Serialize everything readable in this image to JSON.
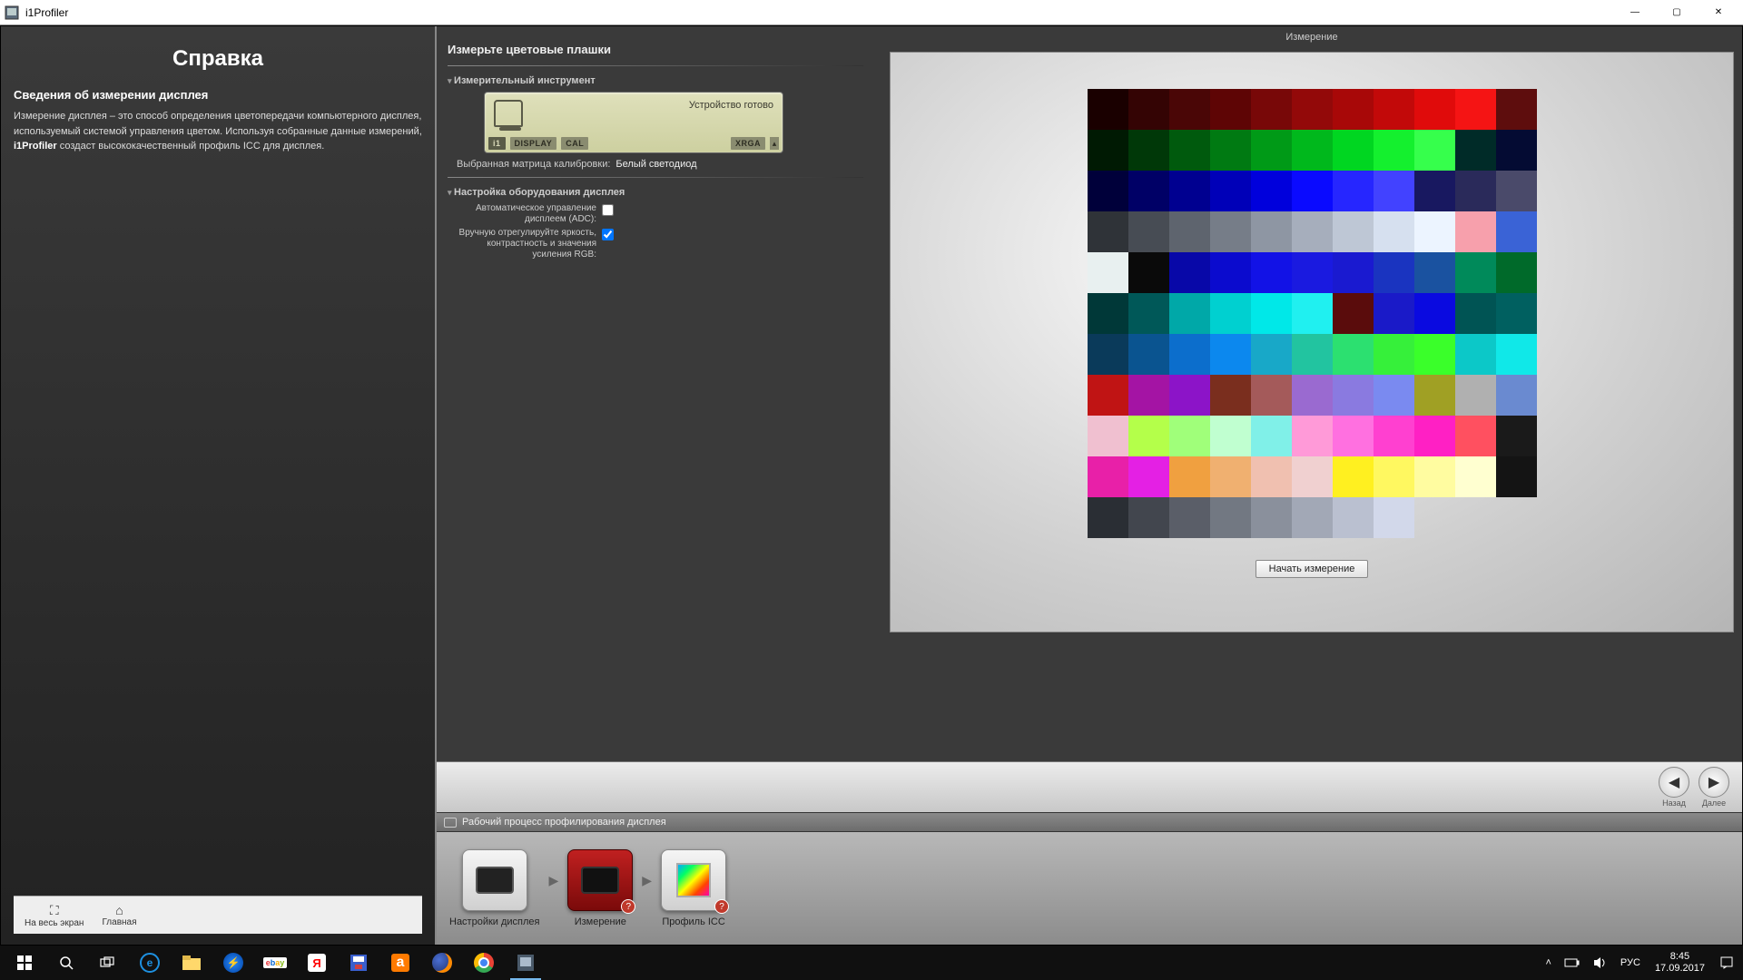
{
  "window": {
    "title": "i1Profiler",
    "minimize": "—",
    "maximize": "▢",
    "close": "✕"
  },
  "help": {
    "title": "Справка",
    "subtitle": "Сведения об измерении дисплея",
    "body_pre": "Измерение дисплея – это способ определения цветопередачи компьютерного дисплея, используемый системой управления цветом. Используя собранные данные измерений, ",
    "body_bold": "i1Profiler",
    "body_post": " создаст высококачественный профиль ICC для дисплея.",
    "footer_fullscreen": "На весь экран",
    "footer_home": "Главная"
  },
  "page": {
    "heading": "Измерьте цветовые плашки"
  },
  "instrument": {
    "section": "Измерительный инструмент",
    "status": "Устройство готово",
    "badge_i1": "i1",
    "badge_display": "DISPLAY",
    "badge_cal": "CAL",
    "badge_xrga": "XRGA",
    "matrix_label": "Выбранная матрица калибровки:",
    "matrix_value": "Белый светодиод"
  },
  "hardware": {
    "section": "Настройка оборудования дисплея",
    "adc_label": "Автоматическое управление дисплеем (ADC):",
    "manual_label": "Вручную отрегулируйте яркость, контрастность и значения усиления RGB:"
  },
  "preview": {
    "title": "Измерение",
    "start": "Начать измерение",
    "patches": [
      [
        "#1a0000",
        "#340404",
        "#4a0606",
        "#5e0505",
        "#780808",
        "#930909",
        "#a80808",
        "#c20909",
        "#e00b0b",
        "#f51414",
        "#5e0d0d"
      ],
      [
        "#001a03",
        "#003808",
        "#005a0d",
        "#007a12",
        "#009a17",
        "#00b81c",
        "#00d621",
        "#14f02e",
        "#36ff4c",
        "#002b28",
        "#040b33"
      ],
      [
        "#00003a",
        "#000066",
        "#000090",
        "#0000b8",
        "#0000dc",
        "#0a0aff",
        "#2626ff",
        "#4242ff",
        "#181860",
        "#2a2a5a",
        "#4a4a6a"
      ],
      [
        "#2f3338",
        "#474c54",
        "#5e646e",
        "#767d88",
        "#8e96a3",
        "#a6aebc",
        "#bec7d5",
        "#d6e0ef",
        "#ecf4ff",
        "#f7a0ac",
        "#3a63d6"
      ],
      [
        "#e8f0f0",
        "#0a0a0a",
        "#0808a8",
        "#0b0bce",
        "#1212e6",
        "#1a1ae0",
        "#1a1ad0",
        "#1a34c0",
        "#1a52a0",
        "#008a5a",
        "#006a2a"
      ],
      [
        "#003838",
        "#005858",
        "#00a8a8",
        "#00d0d0",
        "#00e8e8",
        "#20f0f0",
        "#5a0c0c",
        "#1a1ac8",
        "#0a0ae0",
        "#005454",
        "#006060"
      ],
      [
        "#0a3a5a",
        "#0a5490",
        "#0c6ecc",
        "#0c88ee",
        "#18a8c8",
        "#22c4a0",
        "#2ce070",
        "#36f03a",
        "#3aff2a",
        "#0cc8c8",
        "#10e8e8"
      ],
      [
        "#c01414",
        "#a414a4",
        "#8c14c8",
        "#7a2e1e",
        "#a45a5a",
        "#9a6ad0",
        "#8a7ae0",
        "#7a8af0",
        "#a0a024",
        "#b0b0b0",
        "#6a8ad0"
      ],
      [
        "#f0c0d0",
        "#b4ff4a",
        "#a0ff7a",
        "#c0ffd0",
        "#80f0e8",
        "#ff9ad8",
        "#ff70e0",
        "#ff40d0",
        "#ff20c4",
        "#ff5060",
        "#1a1a1a"
      ],
      [
        "#e820a8",
        "#e420e4",
        "#f0a040",
        "#f0b070",
        "#f0c0b0",
        "#f0d0d0",
        "#fff020",
        "#fff860",
        "#fffca0",
        "#ffffd0",
        "#141414"
      ],
      [
        "#2a2e34",
        "#42464e",
        "#5a5e68",
        "#727882",
        "#8a909c",
        "#a2a8b6",
        "#bac0d0",
        "#d2d8ea",
        "",
        "",
        ""
      ]
    ]
  },
  "nav": {
    "back": "Назад",
    "next": "Далее"
  },
  "workflow": {
    "title": "Рабочий процесс профилирования дисплея",
    "steps": [
      {
        "label": "Настройки дисплея"
      },
      {
        "label": "Измерение"
      },
      {
        "label": "Профиль ICC"
      }
    ]
  },
  "taskbar": {
    "lang": "РУС",
    "time": "8:45",
    "date": "17.09.2017"
  }
}
